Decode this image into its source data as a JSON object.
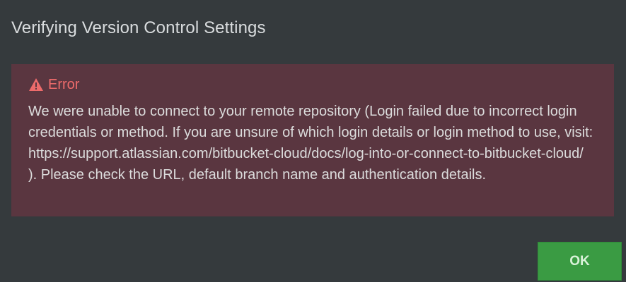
{
  "dialog": {
    "title": "Verifying Version Control Settings"
  },
  "error": {
    "icon": "warning-triangle-icon",
    "heading": "Error",
    "message": "We were unable to connect to your remote repository (Login failed due to incorrect login credentials or method. If you are unsure of which login details or login method to use, visit: https://support.atlassian.com/bitbucket-cloud/docs/log-into-or-connect-to-bitbucket-cloud/ ). Please check the URL, default branch name and authentication details.",
    "accent_color": "#ee6b6b",
    "background_color": "#5a3640"
  },
  "buttons": {
    "ok_label": "OK",
    "ok_color": "#3a9b43"
  }
}
